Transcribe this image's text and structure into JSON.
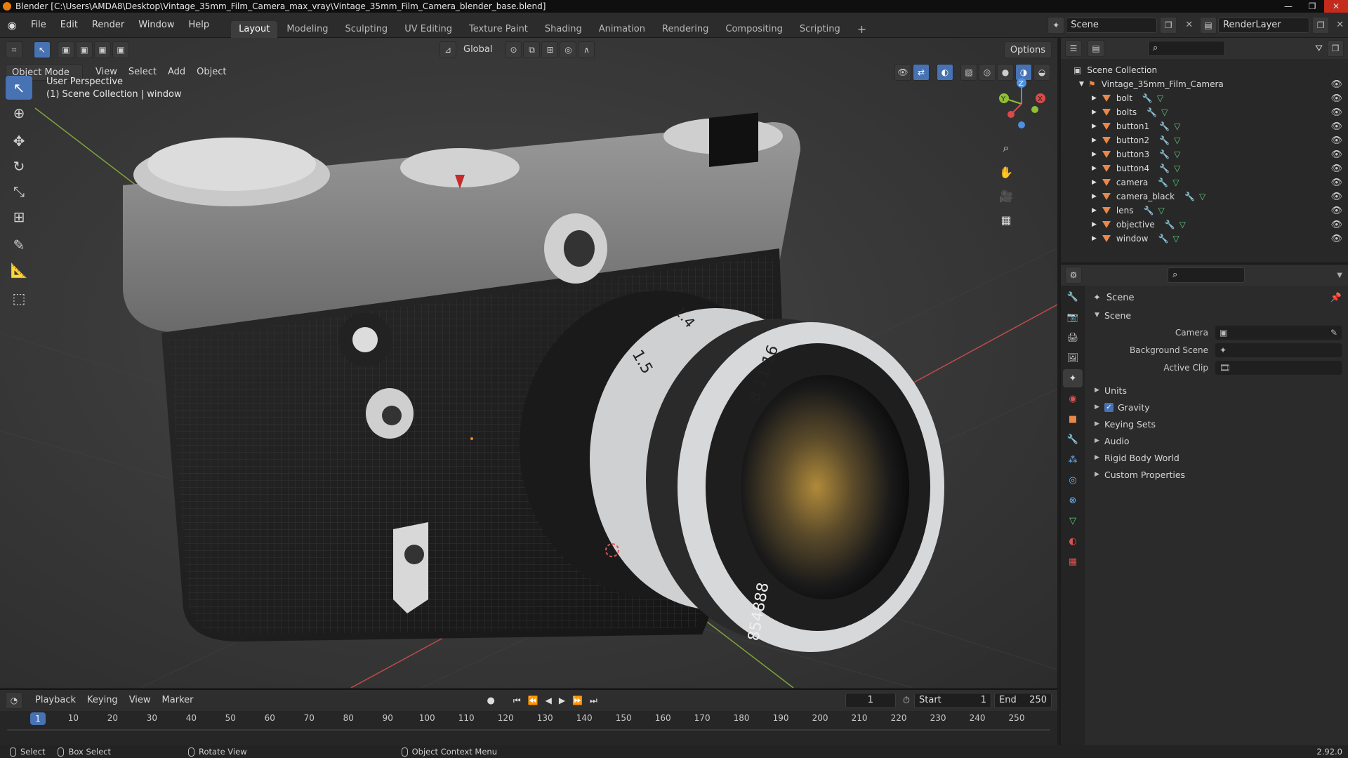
{
  "window": {
    "title": "Blender [C:\\Users\\AMDA8\\Desktop\\Vintage_35mm_Film_Camera_max_vray\\Vintage_35mm_Film_Camera_blender_base.blend]",
    "minimize": "—",
    "maximize": "❐",
    "close": "✕"
  },
  "menus": [
    "File",
    "Edit",
    "Render",
    "Window",
    "Help"
  ],
  "workspaces": {
    "tabs": [
      "Layout",
      "Modeling",
      "Sculpting",
      "UV Editing",
      "Texture Paint",
      "Shading",
      "Animation",
      "Rendering",
      "Compositing",
      "Scripting"
    ],
    "active": "Layout",
    "add": "+"
  },
  "scene_selector": {
    "label": "Scene",
    "layer": "RenderLayer"
  },
  "viewport": {
    "mode": "Object Mode",
    "menus": [
      "View",
      "Select",
      "Add",
      "Object"
    ],
    "orientation": "Global",
    "options": "Options",
    "overlay_title": "User Perspective",
    "overlay_subtitle": "(1) Scene Collection | window",
    "gizmo": {
      "x": "X",
      "y": "Y",
      "z": "Z"
    }
  },
  "outliner": {
    "root": "Scene Collection",
    "collection": "Vintage_35mm_Film_Camera",
    "objects": [
      "bolt",
      "bolts",
      "button1",
      "button2",
      "button3",
      "button4",
      "camera",
      "camera_black",
      "lens",
      "objective",
      "window"
    ]
  },
  "properties": {
    "breadcrumb": "Scene",
    "section": "Scene",
    "fields": [
      {
        "label": "Camera",
        "value": ""
      },
      {
        "label": "Background Scene",
        "value": ""
      },
      {
        "label": "Active Clip",
        "value": ""
      }
    ],
    "panels": [
      {
        "label": "Units",
        "checkbox": false
      },
      {
        "label": "Gravity",
        "checkbox": true
      },
      {
        "label": "Keying Sets",
        "checkbox": false
      },
      {
        "label": "Audio",
        "checkbox": false
      },
      {
        "label": "Rigid Body World",
        "checkbox": false
      },
      {
        "label": "Custom Properties",
        "checkbox": false
      }
    ]
  },
  "timeline": {
    "menus": [
      "Playback",
      "Keying",
      "View",
      "Marker"
    ],
    "current_frame": "1",
    "start_label": "Start",
    "start": "1",
    "end_label": "End",
    "end": "250",
    "ticks": [
      "10",
      "20",
      "30",
      "40",
      "50",
      "60",
      "70",
      "80",
      "90",
      "100",
      "110",
      "120",
      "130",
      "140",
      "150",
      "160",
      "170",
      "180",
      "190",
      "200",
      "210",
      "220",
      "230",
      "240",
      "250"
    ],
    "playhead": "1"
  },
  "statusbar": {
    "select": "Select",
    "box_select": "Box Select",
    "rotate_view": "Rotate View",
    "context_menu": "Object Context Menu",
    "version": "2.92.0"
  },
  "lens_text": {
    "scale1": "1.5",
    "scale2": "1.4",
    "scale3": "8 11 16",
    "serial": "854888"
  },
  "colors": {
    "accent": "#4772b3",
    "object_orange": "#e8884a",
    "mesh_green": "#5cd17a",
    "x_axis": "#d94a4a",
    "y_axis": "#8fbf35",
    "z_axis": "#4d8fe0"
  }
}
